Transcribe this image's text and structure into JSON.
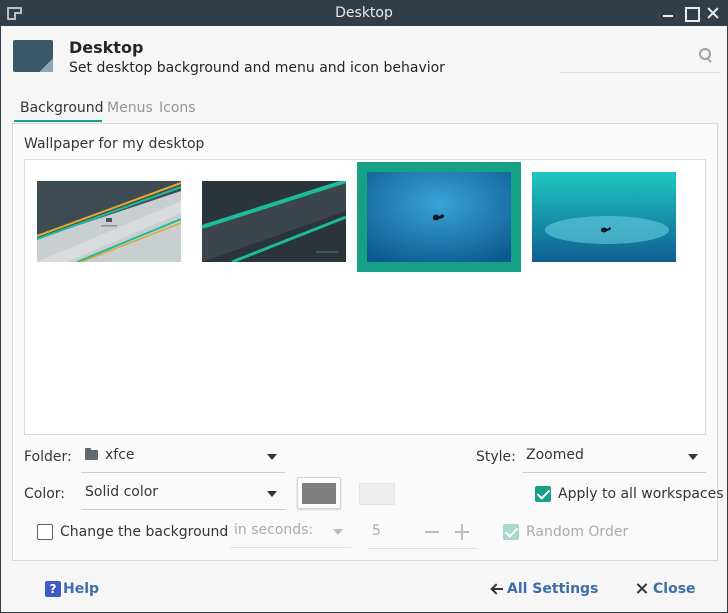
{
  "window": {
    "title": "Desktop"
  },
  "header": {
    "title": "Desktop",
    "subtitle": "Set desktop background and menu and icon behavior"
  },
  "tabs": [
    {
      "label": "Background",
      "active": true
    },
    {
      "label": "Menus",
      "active": false
    },
    {
      "label": "Icons",
      "active": false
    }
  ],
  "wallpaper": {
    "label": "Wallpaper for my desktop",
    "thumbnails": [
      {
        "name": "wallpaper-1",
        "selected": false
      },
      {
        "name": "wallpaper-2",
        "selected": false
      },
      {
        "name": "wallpaper-3",
        "selected": true
      },
      {
        "name": "wallpaper-4",
        "selected": false
      }
    ]
  },
  "form": {
    "folder_label": "Folder:",
    "folder_value": "xfce",
    "style_label": "Style:",
    "style_value": "Zoomed",
    "color_label": "Color:",
    "color_value": "Solid color",
    "primary_color": "#7f7f7f",
    "secondary_color": "#eeeeee",
    "apply_all_label": "Apply to all workspaces",
    "apply_all_checked": true,
    "change_bg_label": "Change the background",
    "change_bg_checked": false,
    "interval_unit": "in seconds:",
    "interval_value": "5",
    "random_order_label": "Random Order",
    "random_order_checked": true
  },
  "footer": {
    "help_label": "Help",
    "all_settings_label": "All Settings",
    "close_label": "Close"
  },
  "colors": {
    "accent": "#16a085",
    "titlebar": "#2f3e48",
    "link": "#3e6daa"
  }
}
